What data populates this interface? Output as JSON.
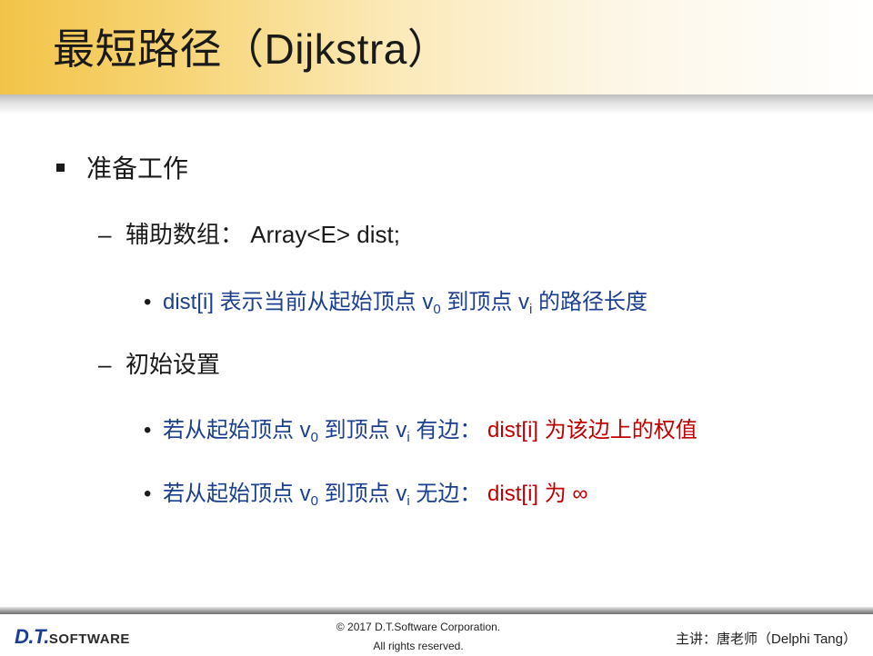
{
  "title": "最短路径（Dijkstra）",
  "level1": {
    "text": "准备工作"
  },
  "aux": {
    "label": "辅助数组：",
    "code": "Array<E> dist;"
  },
  "dist_desc": {
    "a": "dist[i] 表示当前从起始顶点 v",
    "sub0": "0",
    "b": " 到顶点 v",
    "subi": "i",
    "c": " 的路径长度"
  },
  "init": {
    "text": "初始设置"
  },
  "edge_case": {
    "a": "若从起始顶点 v",
    "sub0": "0",
    "b": " 到顶点 v",
    "subi": "i",
    "c": " 有边：",
    "result": "dist[i] 为该边上的权值"
  },
  "noedge_case": {
    "a": "若从起始顶点 v",
    "sub0": "0",
    "b": " 到顶点 v",
    "subi": "i",
    "c": " 无边：",
    "result": "dist[i] 为 ∞"
  },
  "footer": {
    "logo_dt": "D.T.",
    "logo_software": "SOFTWARE",
    "copyright_line1": "© 2017 D.T.Software Corporation.",
    "copyright_line2": "All rights reserved.",
    "lecturer": "主讲：唐老师（Delphi Tang）"
  },
  "colors": {
    "title_band": "#f2c347",
    "text_blue": "#1a3f8f",
    "text_red": "#c00000",
    "logo_blue": "#1b3f94",
    "logo_red": "#d01818"
  }
}
